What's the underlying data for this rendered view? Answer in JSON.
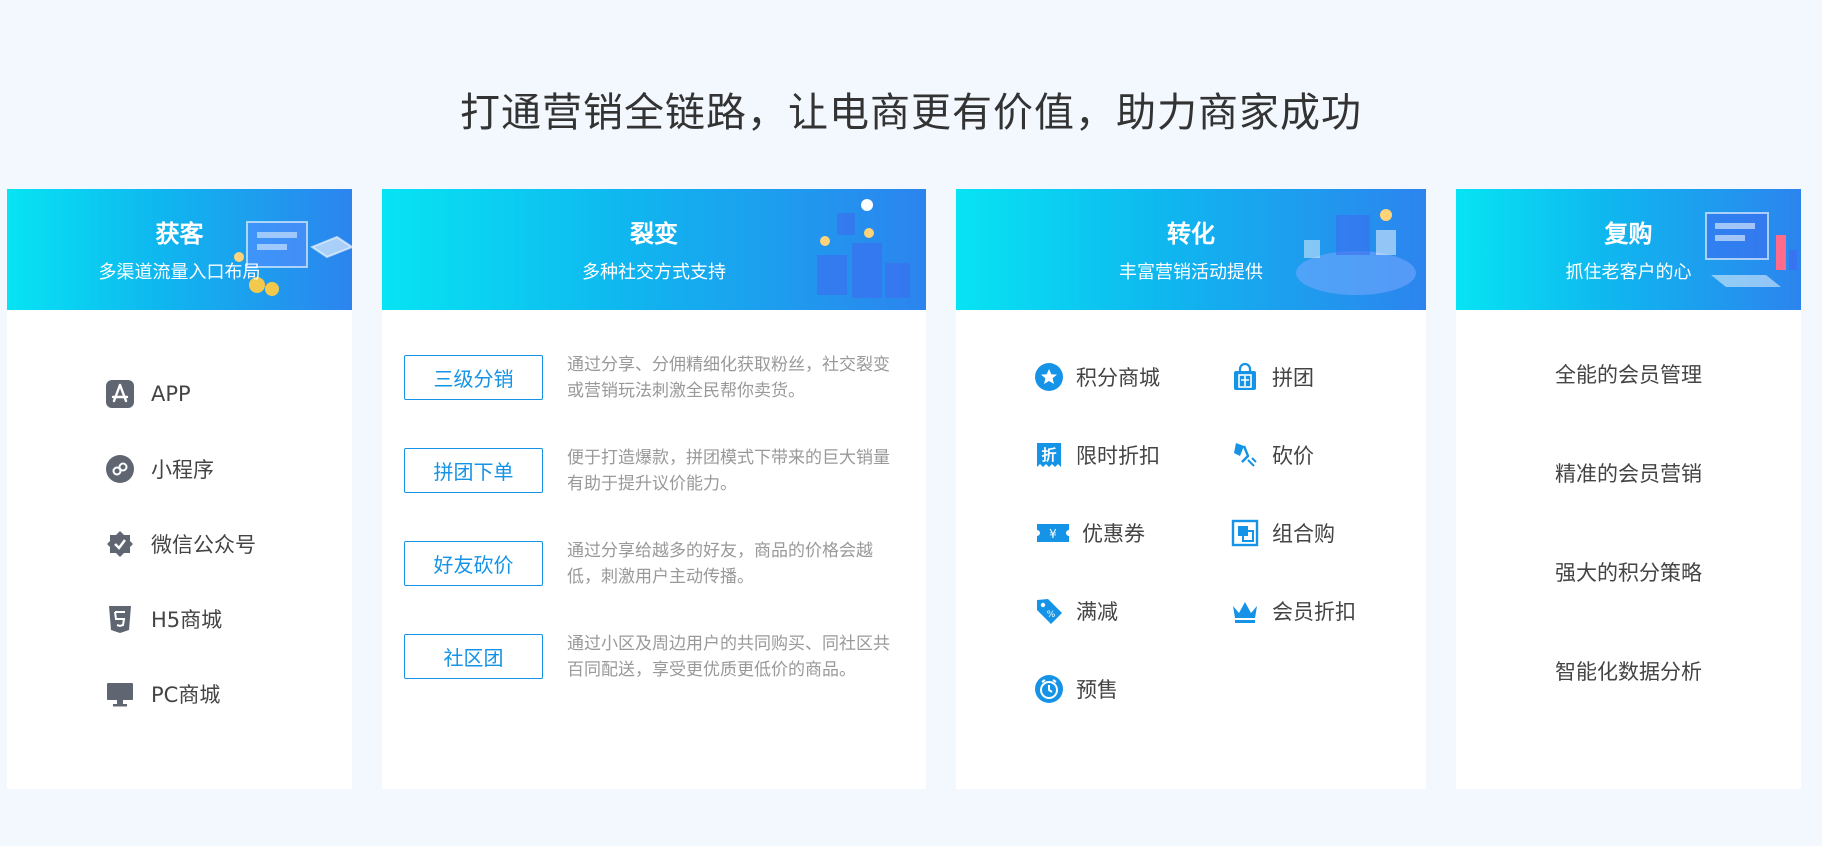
{
  "page": {
    "title": "打通营销全链路，让电商更有价值，助力商家成功"
  },
  "cards": {
    "acquire": {
      "title": "获客",
      "subtitle": "多渠道流量入口布局",
      "items": [
        {
          "label": "APP",
          "icon": "app-store-icon"
        },
        {
          "label": "小程序",
          "icon": "mini-program-icon"
        },
        {
          "label": "微信公众号",
          "icon": "wechat-verified-icon"
        },
        {
          "label": "H5商城",
          "icon": "html5-icon"
        },
        {
          "label": "PC商城",
          "icon": "monitor-icon"
        }
      ]
    },
    "fission": {
      "title": "裂变",
      "subtitle": "多种社交方式支持",
      "items": [
        {
          "tag": "三级分销",
          "desc": "通过分享、分佣精细化获取粉丝，社交裂变或营销玩法刺激全民帮你卖货。"
        },
        {
          "tag": "拼团下单",
          "desc": "便于打造爆款，拼团模式下带来的巨大销量有助于提升议价能力。"
        },
        {
          "tag": "好友砍价",
          "desc": "通过分享给越多的好友，商品的价格会越低，刺激用户主动传播。"
        },
        {
          "tag": "社区团",
          "desc": "通过小区及周边用户的共同购买、同社区共百同配送，享受更优质更低价的商品。"
        }
      ]
    },
    "convert": {
      "title": "转化",
      "subtitle": "丰富营销活动提供",
      "items": [
        {
          "label": "积分商城",
          "icon": "star-icon"
        },
        {
          "label": "拼团",
          "icon": "group-bag-icon"
        },
        {
          "label": "限时折扣",
          "icon": "discount-badge-icon"
        },
        {
          "label": "砍价",
          "icon": "bargain-icon"
        },
        {
          "label": "优惠券",
          "icon": "coupon-icon"
        },
        {
          "label": "组合购",
          "icon": "combo-icon"
        },
        {
          "label": "满减",
          "icon": "price-tag-icon"
        },
        {
          "label": "会员折扣",
          "icon": "crown-icon"
        },
        {
          "label": "预售",
          "icon": "presale-clock-icon"
        }
      ]
    },
    "repurchase": {
      "title": "复购",
      "subtitle": "抓住老客户的心",
      "items": [
        {
          "label": "全能的会员管理"
        },
        {
          "label": "精准的会员营销"
        },
        {
          "label": "强大的积分策略"
        },
        {
          "label": "智能化数据分析"
        }
      ]
    }
  },
  "colors": {
    "accent": "#1593e6",
    "icon_gray": "#5f6672",
    "head_start": "#07e4f3",
    "head_end": "#2c84ee"
  }
}
